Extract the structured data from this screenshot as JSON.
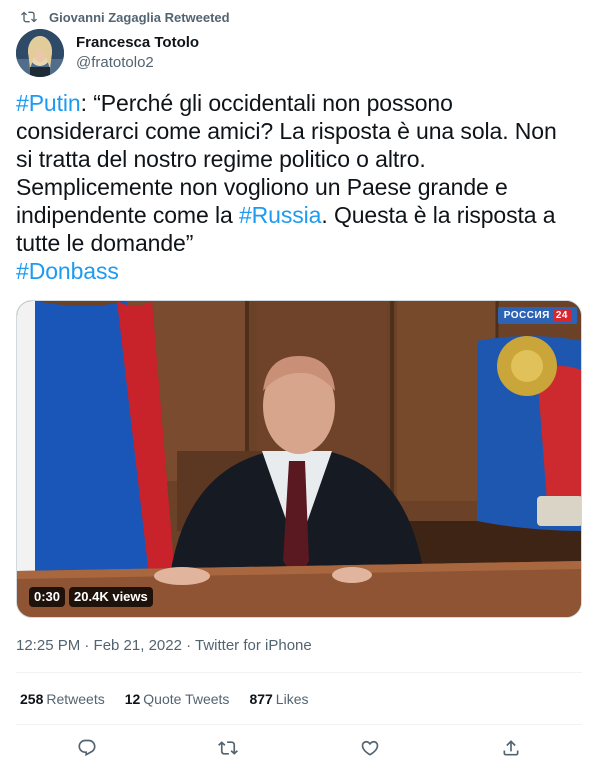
{
  "retweet": {
    "label": "Giovanni Zagaglia Retweeted",
    "icon": "retweet-icon"
  },
  "author": {
    "display_name": "Francesca Totolo",
    "handle": "@fratotolo2"
  },
  "tweet": {
    "lines": [
      {
        "tag": "#Putin",
        "text": ": “Perché gli occidentali non possono"
      },
      {
        "text": "considerarci come amici? La risposta è una sola. Non"
      },
      {
        "text": "si tratta del nostro regime politico o altro."
      },
      {
        "text": "Semplicemente non vogliono un Paese grande e"
      },
      {
        "pre": "indipendente come la ",
        "tag": "#Russia",
        "text": ". Questa è la risposta a"
      },
      {
        "text": "tutte le domande”"
      },
      {
        "tag": "#Donbass"
      }
    ]
  },
  "media": {
    "channel_name": "РОССИЯ",
    "channel_num": "24",
    "duration": "0:30",
    "views": "20.4K views"
  },
  "timestamp": "12:25 PM · Feb 21, 2022 · Twitter for iPhone",
  "stats": {
    "retweets": {
      "count": "258",
      "label": "Retweets"
    },
    "quotes": {
      "count": "12",
      "label": "Quote Tweets"
    },
    "likes": {
      "count": "877",
      "label": "Likes"
    }
  },
  "colors": {
    "link": "#1d9bf0",
    "secondary": "#536471",
    "text": "#0f1419",
    "divider": "#eff3f4"
  },
  "actions": [
    "reply-icon",
    "retweet-icon",
    "like-icon",
    "share-icon"
  ]
}
